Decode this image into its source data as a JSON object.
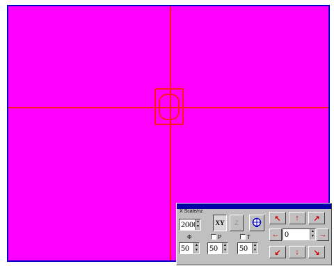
{
  "panel": {
    "title": "X Scale/nz",
    "zoom_value": "2000",
    "mode_buttons": [
      "XY",
      "Z"
    ],
    "labels": [
      "Φ",
      "P",
      "T"
    ],
    "spin_values": [
      "50",
      "50",
      "50"
    ],
    "offset_value": "0"
  },
  "colors": {
    "canvas": "#ff00ff",
    "crosshair": "#ff1a1a",
    "frame": "#0000c8",
    "panel": "#c0c0c0"
  }
}
